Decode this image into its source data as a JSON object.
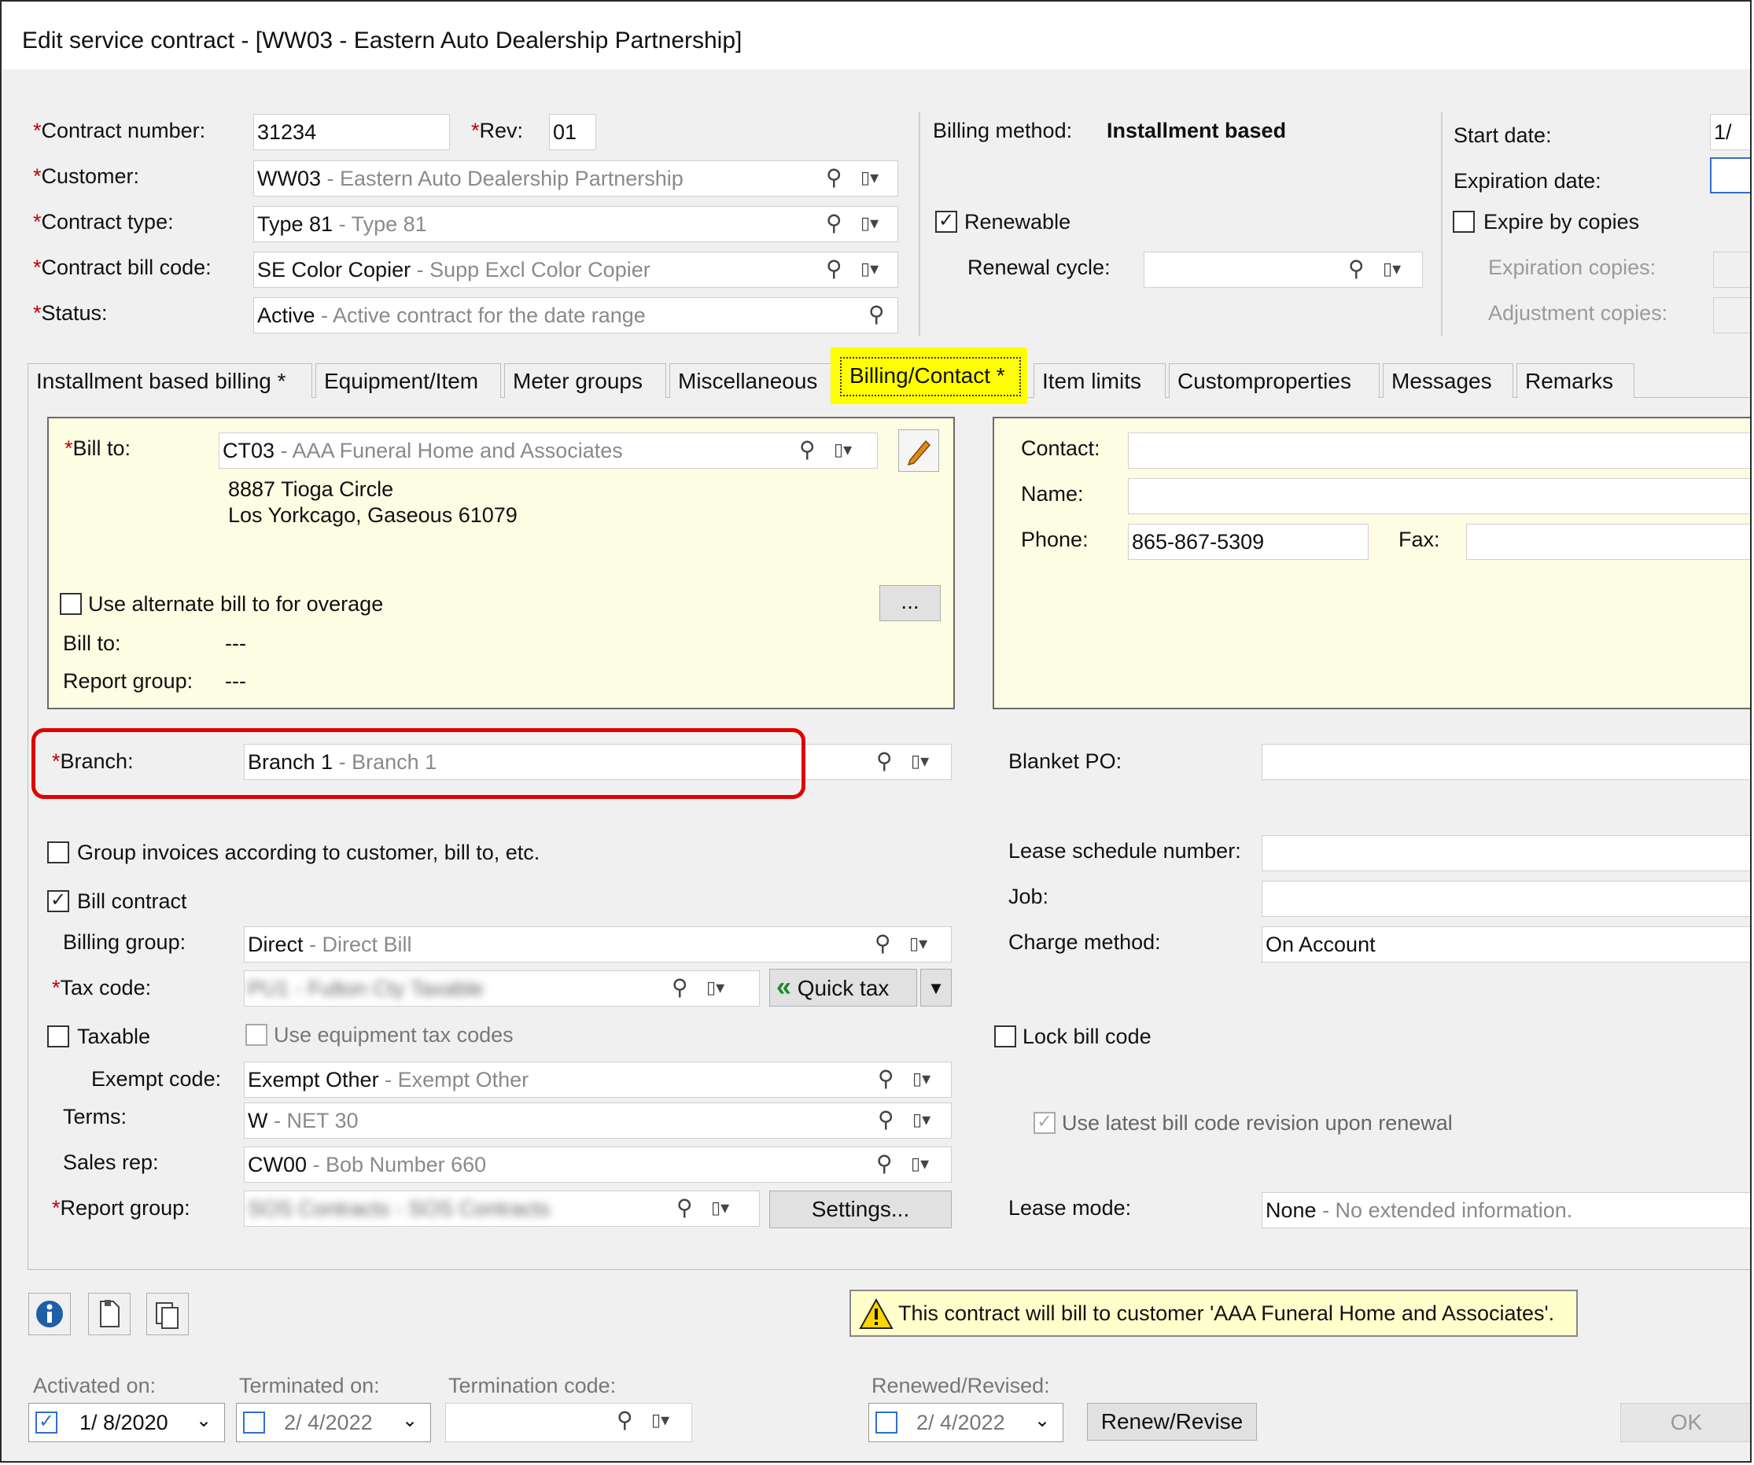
{
  "window": {
    "title": "Edit service contract - [WW03 - Eastern Auto Dealership Partnership]"
  },
  "header": {
    "contract_number": {
      "label": "Contract number:",
      "value": "31234"
    },
    "rev": {
      "label": "Rev:",
      "value": "01"
    },
    "customer": {
      "label": "Customer:",
      "code": "WW03",
      "desc": "- Eastern Auto Dealership Partnership"
    },
    "contract_type": {
      "label": "Contract type:",
      "code": "Type 81",
      "desc": "- Type 81"
    },
    "contract_bill_code": {
      "label": "Contract bill code:",
      "code": "SE Color Copier",
      "desc": "- Supp Excl Color Copier"
    },
    "status": {
      "label": "Status:",
      "code": "Active",
      "desc": "- Active contract for the date range"
    },
    "billing_method_label": "Billing method:",
    "billing_method_value": "Installment based",
    "renewable_label": "Renewable",
    "renewal_cycle_label": "Renewal cycle:",
    "start_date_label": "Start date:",
    "start_date_value": "1/",
    "expiration_date_label": "Expiration date:",
    "expire_by_copies_label": "Expire by copies",
    "expiration_copies_label": "Expiration copies:",
    "adjustment_copies_label": "Adjustment copies:"
  },
  "tabs": [
    {
      "label": "Installment based billing *"
    },
    {
      "label": "Equipment/Item"
    },
    {
      "label": "Meter groups"
    },
    {
      "label": "Miscellaneous"
    },
    {
      "label": "Billing/Contact *"
    },
    {
      "label": "Item limits"
    },
    {
      "label": "Customproperties"
    },
    {
      "label": "Messages"
    },
    {
      "label": "Remarks"
    }
  ],
  "billto": {
    "label": "Bill to:",
    "code": "CT03",
    "desc": "- AAA Funeral Home and Associates",
    "address1": "8887 Tioga Circle",
    "address2": "Los Yorkcago, Gaseous 61079",
    "alt_label": "Use alternate bill to for overage",
    "ellipsis": "...",
    "alt_billto_label": "Bill to:",
    "alt_billto_value": "---",
    "report_group_label": "Report group:",
    "report_group_value": "---"
  },
  "contact": {
    "contact_label": "Contact:",
    "name_label": "Name:",
    "phone_label": "Phone:",
    "phone_value": "865-867-5309",
    "fax_label": "Fax:"
  },
  "branch": {
    "label": "Branch:",
    "code": "Branch 1",
    "desc": "- Branch 1"
  },
  "options": {
    "group_invoices_label": "Group invoices according to customer, bill to, etc.",
    "bill_contract_label": "Bill contract",
    "billing_group": {
      "label": "Billing group:",
      "code": "Direct",
      "desc": "- Direct Bill"
    },
    "tax_code_label": "Tax code:",
    "tax_code_code": "PU1",
    "tax_code_desc": "- Fulton Cty Taxable",
    "quick_tax_label": "Quick tax",
    "taxable_label": "Taxable",
    "use_equipment_tax_label": "Use equipment tax codes",
    "exempt_code": {
      "label": "Exempt code:",
      "code": "Exempt Other",
      "desc": "- Exempt Other"
    },
    "terms": {
      "label": "Terms:",
      "code": "W",
      "desc": "- NET 30"
    },
    "sales_rep": {
      "label": "Sales rep:",
      "code": "CW00",
      "desc": "- Bob Number 660"
    },
    "report_group_label": "Report group:",
    "report_group_code": "SOS Contracts",
    "report_group_desc": "- SOS Contracts",
    "settings_label": "Settings..."
  },
  "right": {
    "blanket_po_label": "Blanket PO:",
    "lease_schedule_label": "Lease schedule number:",
    "job_label": "Job:",
    "charge_method_label": "Charge method:",
    "charge_method_value": "On Account",
    "lock_bill_code_label": "Lock bill code",
    "use_latest_label": "Use latest bill code revision upon renewal",
    "lease_mode_label": "Lease mode:",
    "lease_mode_code": "None",
    "lease_mode_desc": "- No extended information."
  },
  "footer": {
    "warning": "This contract will bill to customer 'AAA Funeral Home and Associates'.",
    "activated_label": "Activated on:",
    "activated_value": "1/ 8/2020",
    "terminated_label": "Terminated on:",
    "terminated_value": "2/ 4/2022",
    "termination_code_label": "Termination code:",
    "renewed_label": "Renewed/Revised:",
    "renewed_value": "2/ 4/2022",
    "renew_button": "Renew/Revise",
    "ok_button": "OK"
  },
  "colors": {
    "required": "#c00000",
    "highlight": "#ffff00",
    "annotation": "#e00000",
    "panel": "#fdfde4"
  }
}
